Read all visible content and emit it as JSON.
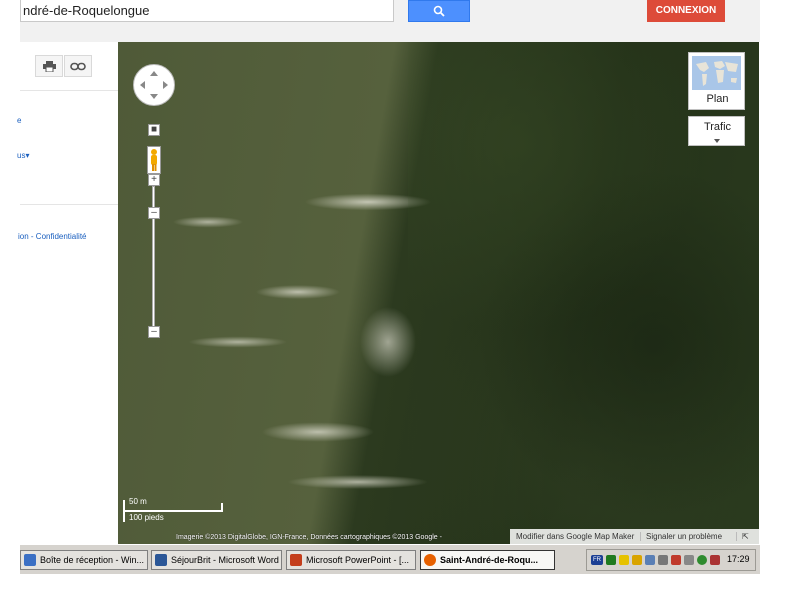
{
  "search": {
    "value": "ndré-de-Roquelongue"
  },
  "header": {
    "connexion_label": "CONNEXION"
  },
  "icons": {
    "search": "search-icon",
    "print": "print-icon",
    "link": "link-icon"
  },
  "left_panel": {
    "link1": "e",
    "link2": "us",
    "footer_text": "ion - Confidentialité"
  },
  "map": {
    "map_type_label": "Plan",
    "traffic_label": "Trafic",
    "scale_m": "50 m",
    "scale_ft": "100 pieds",
    "attribution": "Imagerie ©2013 DigitalGlobe, IGN-France, Données cartographiques ©2013 Google -",
    "footer": {
      "edit_label": "Modifier dans Google Map Maker",
      "report_label": "Signaler un problème"
    }
  },
  "taskbar": {
    "items": [
      {
        "label": "Boîte de réception - Win...",
        "color": "#3a6fc4"
      },
      {
        "label": "SéjourBrit - Microsoft Word",
        "color": "#2b5797"
      },
      {
        "label": "Microsoft PowerPoint - [...",
        "color": "#c43e1c"
      },
      {
        "label": "Saint-André-de-Roqu...",
        "color": "#e66000"
      }
    ],
    "tray": {
      "lang": "FR",
      "time": "17:29"
    }
  },
  "colors": {
    "search_blue": "#4d90fe",
    "connexion_red": "#dd4b39"
  }
}
